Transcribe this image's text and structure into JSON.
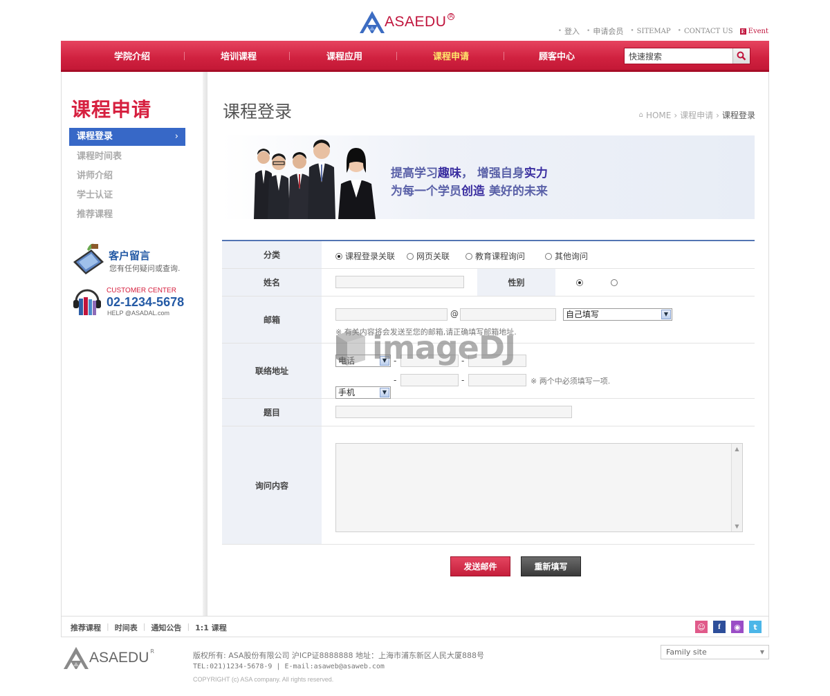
{
  "brand": {
    "name": "ASAEDU",
    "reg": "R"
  },
  "util_links": [
    "登入",
    "申请会员",
    "SITEMAP",
    "CONTACT US",
    "Event"
  ],
  "nav": {
    "items": [
      "学院介绍",
      "培训课程",
      "课程应用",
      "课程申请",
      "顾客中心"
    ],
    "active_index": 3,
    "search_placeholder": "快速搜索"
  },
  "sidebar": {
    "title": "课程申请",
    "items": [
      "课程登录",
      "课程时间表",
      "讲师介绍",
      "学士认证",
      "推荐课程"
    ],
    "message_title": "客户留言",
    "message_sub": "您有任何疑问或查询.",
    "cs_label": "CUSTOMER CENTER",
    "cs_phone": "02-1234-5678",
    "cs_help": "HELP @ASADAL.com"
  },
  "page": {
    "title": "课程登录",
    "breadcrumb": [
      "HOME",
      "课程申请",
      "课程登录"
    ]
  },
  "banner": {
    "line1_a": "提高学习",
    "line1_b": "趣味",
    "line1_c": "，  增强自身",
    "line1_d": "实力",
    "line2_a": "为每一个学员",
    "line2_b": "创造",
    "line2_c": "  美好的未来"
  },
  "form": {
    "category_label": "分类",
    "category_options": [
      "课程登录关联",
      "网页关联",
      "教育课程询问",
      "其他询问"
    ],
    "category_selected": 0,
    "name_label": "姓名",
    "gender_label": "性别",
    "email_label": "邮箱",
    "email_at": "@",
    "email_domain_select": "自己填写",
    "email_note": "※ 有关内容将会发送至您的邮箱,请正确填写邮箱地址.",
    "contact_label": "联络地址",
    "phone_select": "电话",
    "mobile_select": "手机",
    "dash": "-",
    "contact_note": "※ 两个中必须填写一项.",
    "subject_label": "题目",
    "content_label": "询问内容"
  },
  "buttons": {
    "send": "发送邮件",
    "reset": "重新填写"
  },
  "watermark": "imageDJ",
  "footer": {
    "links": [
      "推荐课程",
      "时间表",
      "通知公告",
      "1:1 课程"
    ],
    "copy1": "版权所有: ASA股份有限公司 沪ICP证8888888 地址：上海市浦东新区人民大厦888号",
    "copy2": "TEL:021)1234-5678-9 | E-mail:asaweb@asaweb.com",
    "copy3": "COPYRIGHT (c) ASA company. All rights reserved.",
    "family_site": "Family site"
  },
  "colors": {
    "accent": "#d6203f",
    "nav_active": "#ffe66b",
    "link_blue": "#245aa5",
    "side_active": "#3768c7"
  }
}
